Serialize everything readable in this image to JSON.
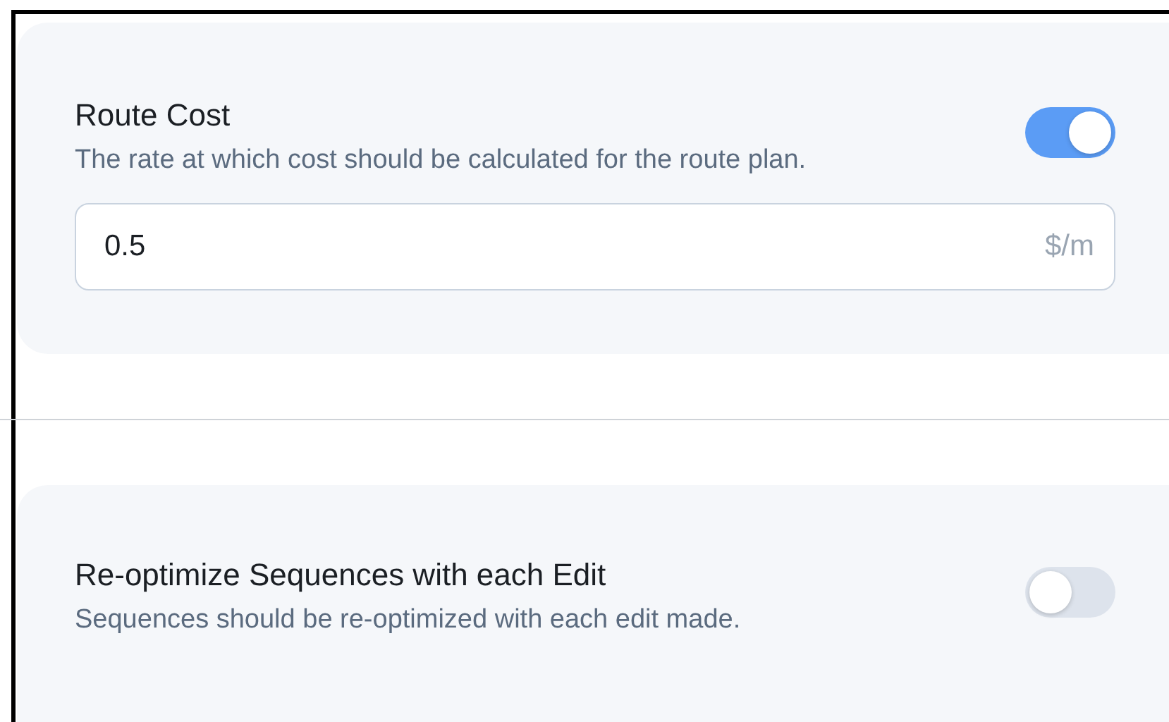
{
  "settings": [
    {
      "title": "Route Cost",
      "description": "The rate at which cost should be calculated for the route plan.",
      "on": true,
      "field": {
        "value": "0.5",
        "unit": "$/m"
      }
    },
    {
      "title": "Re-optimize Sequences with each Edit",
      "description": "Sequences should be re-optimized with each edit made.",
      "on": false
    }
  ]
}
